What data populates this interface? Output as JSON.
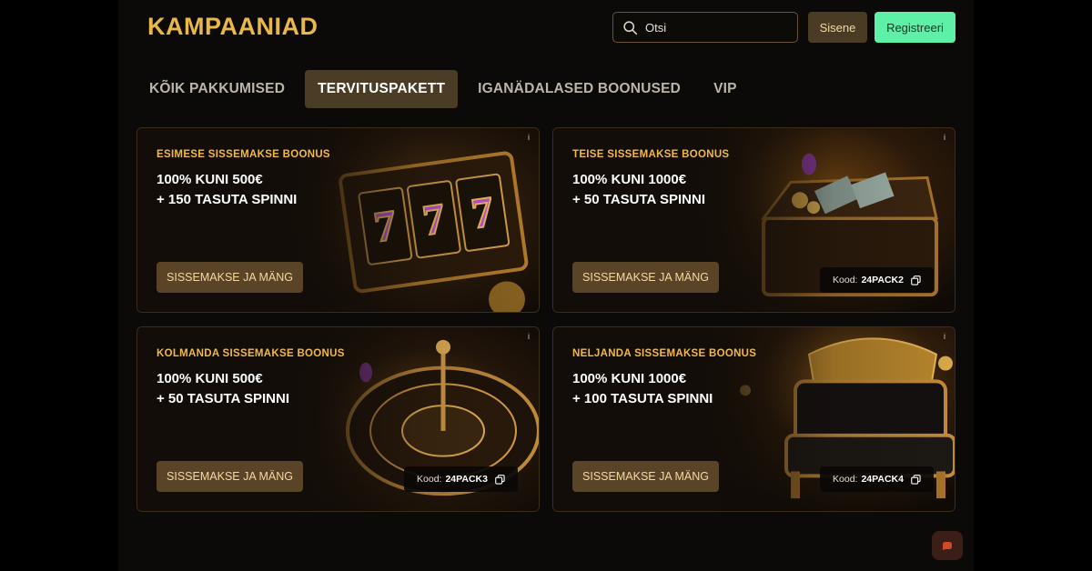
{
  "header": {
    "title": "KAMPAANIAD",
    "search_placeholder": "Otsi",
    "login_label": "Sisene",
    "register_label": "Registreeri"
  },
  "tabs": [
    {
      "label": "KÕIK PAKKUMISED",
      "active": false
    },
    {
      "label": "TERVITUSPAKETT",
      "active": true
    },
    {
      "label": "IGANÄDALASED BOONUSED",
      "active": false
    },
    {
      "label": "VIP",
      "active": false
    }
  ],
  "cards": [
    {
      "label": "ESIMESE SISSEMAKSE BOONUS",
      "line1": "100% KUNI 500€",
      "line2": "+ 150 TASUTA SPINNI",
      "button": "SISSEMAKSE JA MÄNG",
      "info": "i",
      "code_prefix": "",
      "code": "",
      "art": "slot-machine"
    },
    {
      "label": "TEISE SISSEMAKSE BOONUS",
      "line1": "100% KUNI 1000€",
      "line2": "+ 50 TASUTA SPINNI",
      "button": "SISSEMAKSE JA MÄNG",
      "info": "i",
      "code_prefix": "Kood:",
      "code": "24PACK2",
      "art": "treasure-chest"
    },
    {
      "label": "KOLMANDA SISSEMAKSE BOONUS",
      "line1": "100% KUNI 500€",
      "line2": "+ 50 TASUTA SPINNI",
      "button": "SISSEMAKSE JA MÄNG",
      "info": "i",
      "code_prefix": "Kood:",
      "code": "24PACK3",
      "art": "roulette-wheel"
    },
    {
      "label": "NELJANDA SISSEMAKSE BOONUS",
      "line1": "100% KUNI 1000€",
      "line2": "+ 100 TASUTA SPINNI",
      "button": "SISSEMAKSE JA MÄNG",
      "info": "i",
      "code_prefix": "Kood:",
      "code": "24PACK4",
      "art": "throne-chair"
    }
  ],
  "colors": {
    "accent_gold": "#e9b84b",
    "register_green": "#5df0a6",
    "active_tab": "#4b3d25",
    "card_button": "#5a4428"
  },
  "fab_icon": "chat-icon"
}
